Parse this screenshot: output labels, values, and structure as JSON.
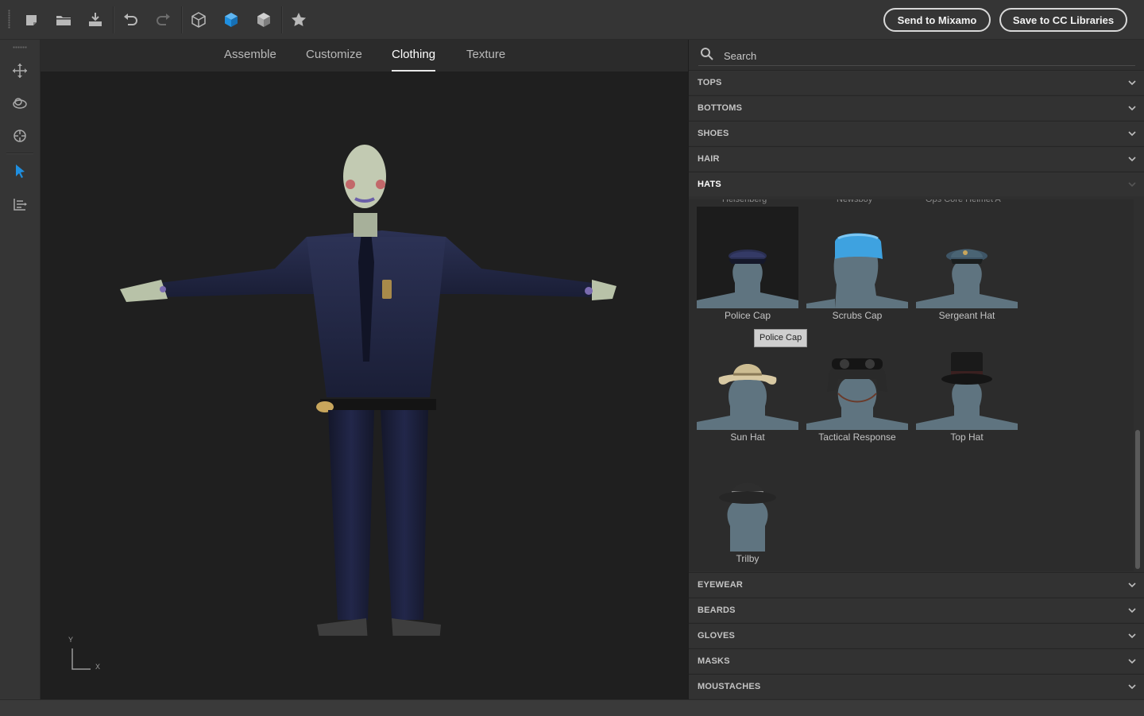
{
  "toolbar": {
    "icons": [
      "new-file",
      "open-folder",
      "save",
      "undo",
      "redo",
      "cube-outline",
      "cube-blue",
      "cube-gray",
      "star"
    ],
    "send_label": "Send to Mixamo",
    "save_label": "Save to CC Libraries"
  },
  "rail": {
    "icons": [
      "move-tool",
      "orbit-tool",
      "target-tool",
      "select-tool",
      "pose-tool"
    ],
    "active": "select-tool"
  },
  "tabs": [
    {
      "label": "Assemble"
    },
    {
      "label": "Customize"
    },
    {
      "label": "Clothing",
      "active": true
    },
    {
      "label": "Texture"
    }
  ],
  "viewport": {
    "axis_y": "Y",
    "axis_x": "X"
  },
  "search": {
    "placeholder": "Search"
  },
  "categories_top": [
    {
      "label": "TOPS"
    },
    {
      "label": "BOTTOMS"
    },
    {
      "label": "SHOES"
    },
    {
      "label": "HAIR"
    },
    {
      "label": "HATS",
      "open": true
    }
  ],
  "hats": {
    "items": [
      {
        "label": "Police Cap",
        "selected": true
      },
      {
        "label": "Scrubs Cap"
      },
      {
        "label": "Sergeant Hat"
      },
      {
        "label": "Sun Hat"
      },
      {
        "label": "Tactical Response"
      },
      {
        "label": "Top Hat"
      },
      {
        "label": "Trilby"
      }
    ],
    "tooltip": "Police Cap"
  },
  "categories_bottom": [
    {
      "label": "EYEWEAR"
    },
    {
      "label": "BEARDS"
    },
    {
      "label": "GLOVES"
    },
    {
      "label": "MASKS"
    },
    {
      "label": "MOUSTACHES"
    }
  ],
  "colors": {
    "accent": "#1f8fe0",
    "panel": "#2f2f2f",
    "toolbar": "#353535"
  }
}
